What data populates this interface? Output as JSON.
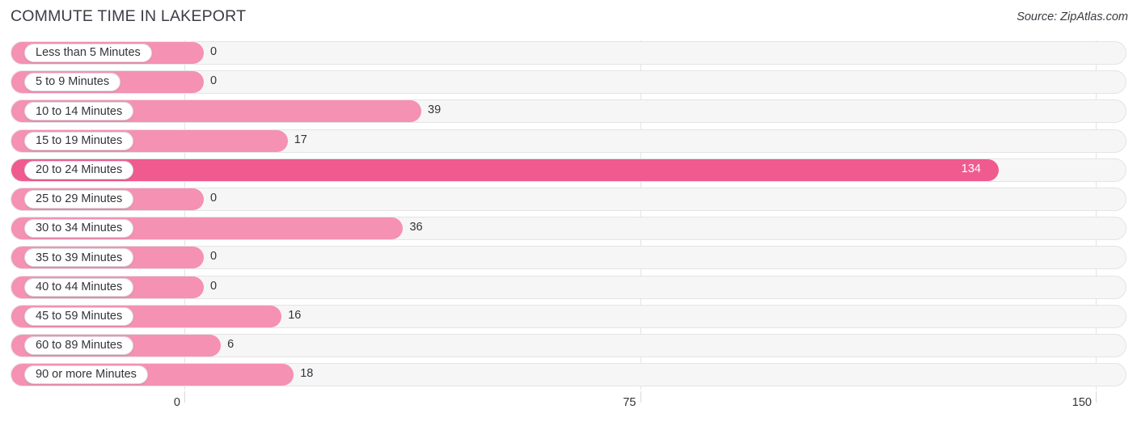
{
  "header": {
    "title": "COMMUTE TIME IN LAKEPORT",
    "source": "Source: ZipAtlas.com"
  },
  "colors": {
    "bar": "#F591B2",
    "bar_highlight": "#EF5B8F",
    "track": "#F6F6F6",
    "track_border": "#E4E4E6",
    "gridline": "#E3E3E6",
    "text": "#33333B",
    "title_text": "#3C3C46",
    "value_on_bar": "#FFFFFF"
  },
  "chart_data": {
    "type": "bar",
    "orientation": "horizontal",
    "title": "COMMUTE TIME IN LAKEPORT",
    "xlabel": "",
    "ylabel": "",
    "xlim": [
      0,
      150
    ],
    "xticks": [
      0,
      75,
      150
    ],
    "xtick_labels": [
      "0",
      "75",
      "150"
    ],
    "grid": true,
    "legend": false,
    "highlight_category": "20 to 24 Minutes",
    "categories": [
      "Less than 5 Minutes",
      "5 to 9 Minutes",
      "10 to 14 Minutes",
      "15 to 19 Minutes",
      "20 to 24 Minutes",
      "25 to 29 Minutes",
      "30 to 34 Minutes",
      "35 to 39 Minutes",
      "40 to 44 Minutes",
      "45 to 59 Minutes",
      "60 to 89 Minutes",
      "90 or more Minutes"
    ],
    "values": [
      0,
      0,
      39,
      17,
      134,
      0,
      36,
      0,
      0,
      16,
      6,
      18
    ],
    "value_labels": [
      "0",
      "0",
      "39",
      "17",
      "134",
      "0",
      "36",
      "0",
      "0",
      "16",
      "6",
      "18"
    ]
  },
  "rows": [
    {
      "label": "Less than 5 Minutes",
      "value": 0,
      "value_label": "0",
      "highlight": false
    },
    {
      "label": "5 to 9 Minutes",
      "value": 0,
      "value_label": "0",
      "highlight": false
    },
    {
      "label": "10 to 14 Minutes",
      "value": 39,
      "value_label": "39",
      "highlight": false
    },
    {
      "label": "15 to 19 Minutes",
      "value": 17,
      "value_label": "17",
      "highlight": false
    },
    {
      "label": "20 to 24 Minutes",
      "value": 134,
      "value_label": "134",
      "highlight": true
    },
    {
      "label": "25 to 29 Minutes",
      "value": 0,
      "value_label": "0",
      "highlight": false
    },
    {
      "label": "30 to 34 Minutes",
      "value": 36,
      "value_label": "36",
      "highlight": false
    },
    {
      "label": "35 to 39 Minutes",
      "value": 0,
      "value_label": "0",
      "highlight": false
    },
    {
      "label": "40 to 44 Minutes",
      "value": 0,
      "value_label": "0",
      "highlight": false
    },
    {
      "label": "45 to 59 Minutes",
      "value": 16,
      "value_label": "16",
      "highlight": false
    },
    {
      "label": "60 to 89 Minutes",
      "value": 6,
      "value_label": "6",
      "highlight": false
    },
    {
      "label": "90 or more Minutes",
      "value": 18,
      "value_label": "18",
      "highlight": false
    }
  ]
}
